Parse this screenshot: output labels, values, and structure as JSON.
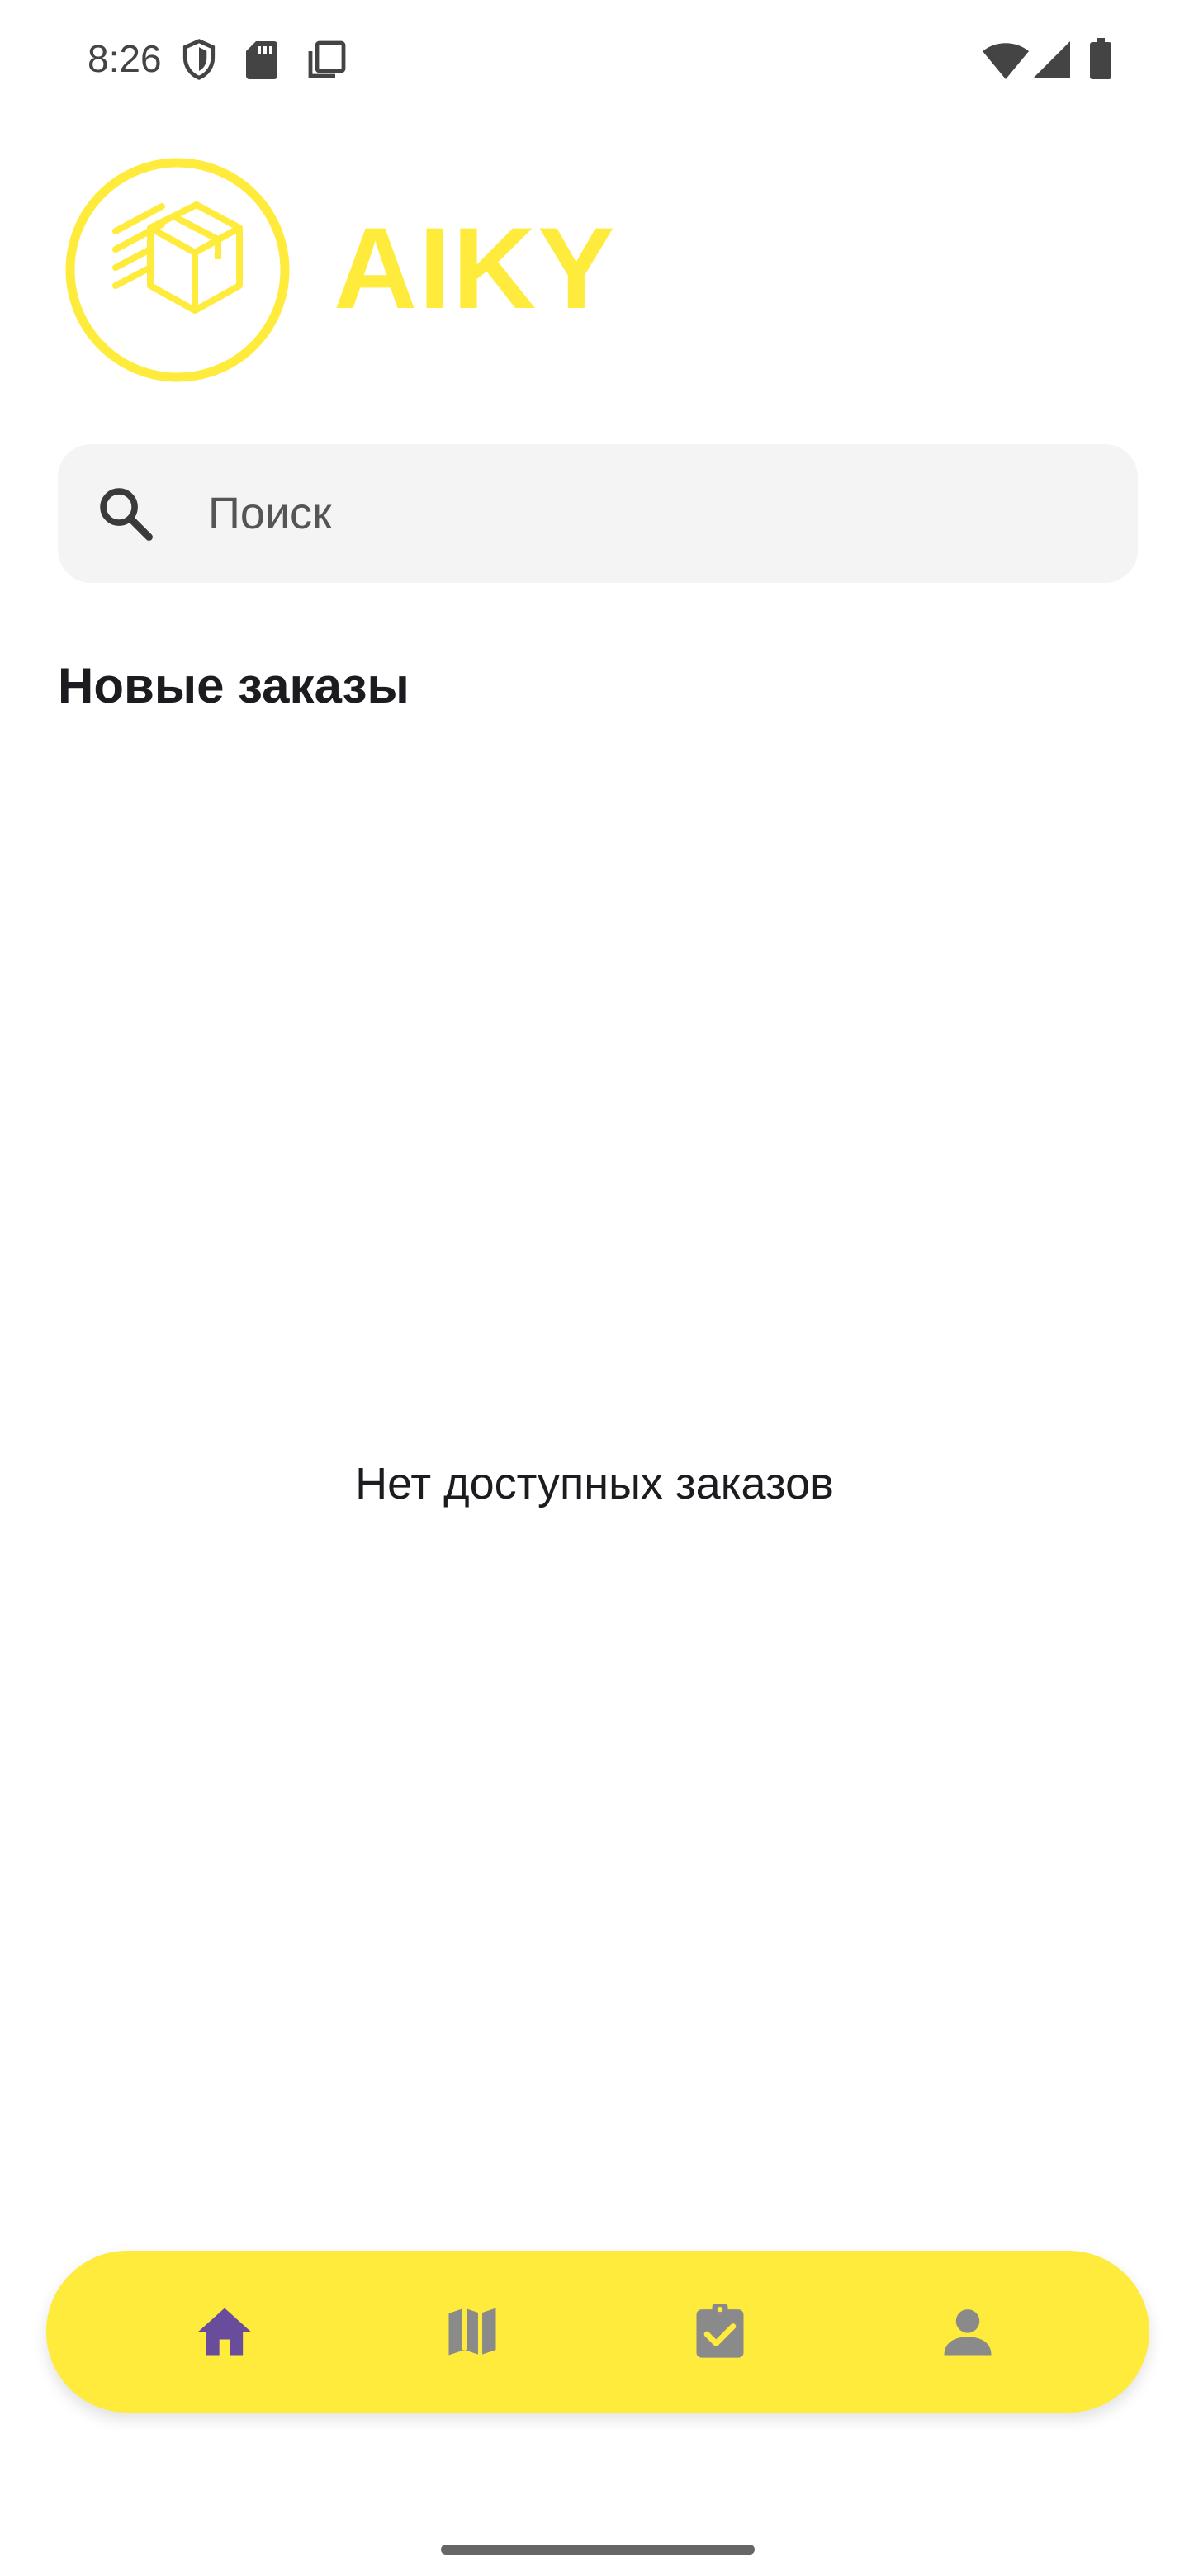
{
  "status_bar": {
    "time": "8:26"
  },
  "header": {
    "brand": "AIKY"
  },
  "search": {
    "placeholder": "Поиск",
    "value": ""
  },
  "orders": {
    "title": "Новые заказы",
    "empty_text": "Нет доступных заказов"
  },
  "bottom_nav": {
    "items": [
      {
        "icon": "home-icon",
        "active": true
      },
      {
        "icon": "map-icon",
        "active": false
      },
      {
        "icon": "assignment-check-icon",
        "active": false
      },
      {
        "icon": "person-icon",
        "active": false
      }
    ]
  },
  "colors": {
    "brand_yellow": "#ffeb3b",
    "active_nav": "#6a4c9c",
    "inactive_nav": "#8a8a8a",
    "search_bg": "#f4f4f4"
  }
}
